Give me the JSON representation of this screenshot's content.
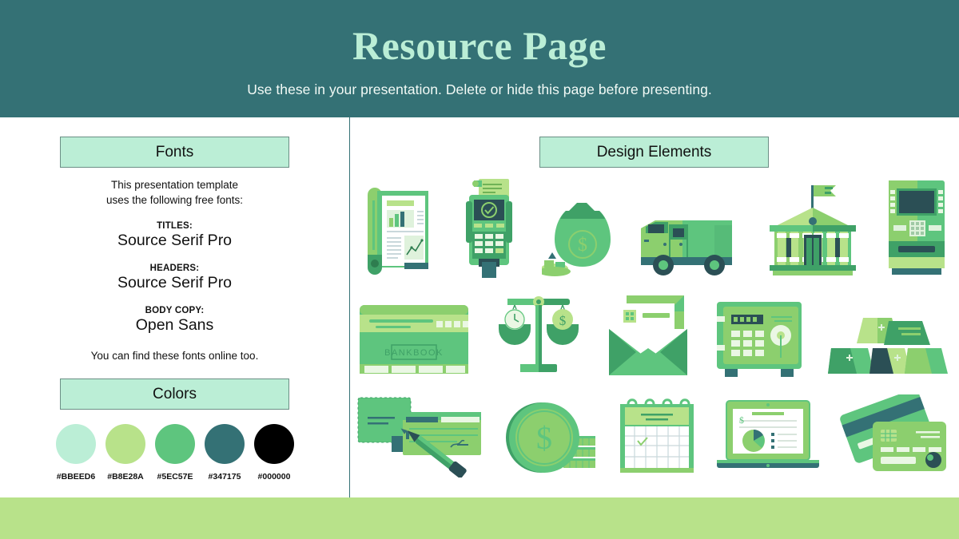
{
  "header": {
    "title": "Resource Page",
    "subtitle": "Use these in your presentation. Delete or hide this page before presenting.",
    "background": "#347175",
    "title_color": "#BBEED6"
  },
  "fonts_section": {
    "heading": "Fonts",
    "intro_line1": "This presentation template",
    "intro_line2": "uses the following free fonts:",
    "groups": [
      {
        "label": "TITLES:",
        "name": "Source Serif Pro"
      },
      {
        "label": "HEADERS:",
        "name": "Source Serif Pro"
      },
      {
        "label": "BODY COPY:",
        "name": "Open Sans"
      }
    ],
    "outro": "You can find these fonts online too."
  },
  "colors_section": {
    "heading": "Colors",
    "swatches": [
      {
        "hex": "#BBEED6",
        "label": "#BBEED6"
      },
      {
        "hex": "#B8E28A",
        "label": "#B8E28A"
      },
      {
        "hex": "#5EC57E",
        "label": "#5EC57E"
      },
      {
        "hex": "#347175",
        "label": "#347175"
      },
      {
        "hex": "#000000",
        "label": "#000000"
      }
    ]
  },
  "design_section": {
    "heading": "Design Elements",
    "rows": [
      [
        "financial-report-icon",
        "pos-terminal-icon",
        "money-bag-icon",
        "armored-truck-icon",
        "bank-building-icon",
        "atm-machine-icon"
      ],
      [
        "bankbook-icon",
        "balance-scale-icon",
        "open-envelope-letter-icon",
        "safe-vault-icon",
        "gold-bars-icon"
      ],
      [
        "checkbook-pen-icon",
        "coins-stack-icon",
        "calendar-icon",
        "laptop-chart-icon",
        "credit-cards-icon"
      ]
    ],
    "bankbook_label": "BANKBOOK",
    "money_symbol": "$"
  },
  "palette": {
    "mint": "#BBEED6",
    "lime": "#B8E28A",
    "green": "#5EC57E",
    "teal": "#347175",
    "black": "#000000",
    "white": "#FFFFFF",
    "dark_green": "#3FA167",
    "light_green": "#8CCF6E"
  },
  "bottom_bar_color": "#B8E28A"
}
